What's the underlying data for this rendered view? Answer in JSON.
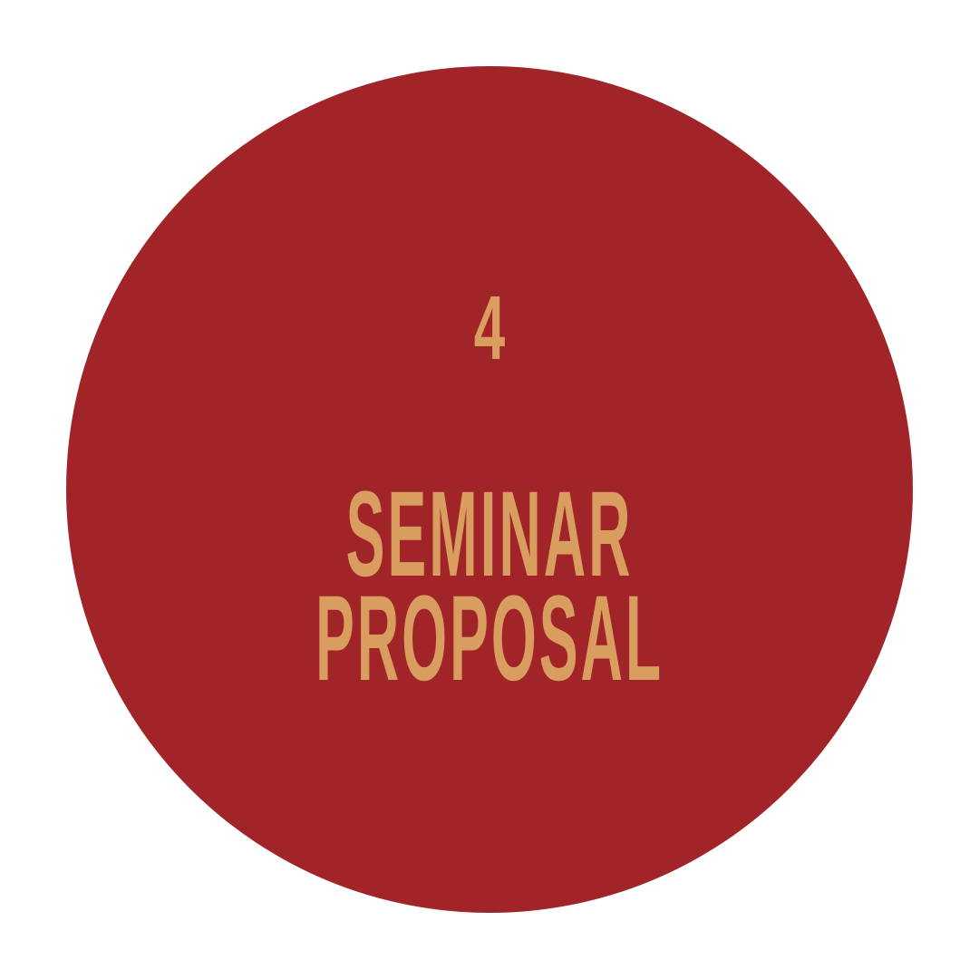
{
  "badge": {
    "number": "4",
    "title_line_1": "SEMINAR",
    "title_line_2": "PROPOSAL"
  },
  "colors": {
    "background": "#ffffff",
    "circle": "#a02428",
    "text": "#d99d5f"
  }
}
